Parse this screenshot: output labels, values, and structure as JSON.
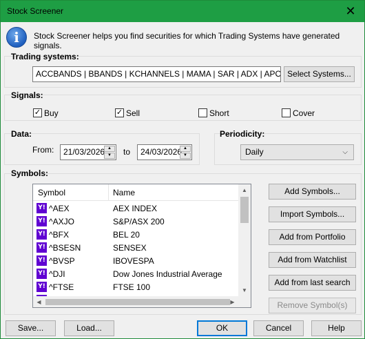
{
  "window": {
    "title": "Stock Screener",
    "close_glyph": "✕"
  },
  "info": {
    "icon": "info-icon",
    "icon_glyph": "i",
    "text": "Stock Screener helps you find securities for which Trading Systems have generated signals."
  },
  "trading_systems": {
    "label": "Trading systems:",
    "value": "ACCBANDS | BBANDS | KCHANNELS | MAMA | SAR | ADX | APO | A",
    "button": "Select Systems..."
  },
  "signals": {
    "label": "Signals:",
    "items": [
      {
        "label": "Buy",
        "checked": true
      },
      {
        "label": "Sell",
        "checked": true
      },
      {
        "label": "Short",
        "checked": false
      },
      {
        "label": "Cover",
        "checked": false
      }
    ]
  },
  "data": {
    "label": "Data:",
    "from_label": "From:",
    "from_value": "21/03/2026",
    "to_label": "to",
    "to_value": "24/03/2026"
  },
  "periodicity": {
    "label": "Periodicity:",
    "value": "Daily"
  },
  "symbols": {
    "label": "Symbols:",
    "columns": [
      "Symbol",
      "Name"
    ],
    "rows": [
      {
        "icon": "Y!",
        "symbol": "^AEX",
        "name": "AEX INDEX"
      },
      {
        "icon": "Y!",
        "symbol": "^AXJO",
        "name": "S&P/ASX 200"
      },
      {
        "icon": "Y!",
        "symbol": "^BFX",
        "name": "BEL 20"
      },
      {
        "icon": "Y!",
        "symbol": "^BSESN",
        "name": "SENSEX"
      },
      {
        "icon": "Y!",
        "symbol": "^BVSP",
        "name": "IBOVESPA"
      },
      {
        "icon": "Y!",
        "symbol": "^DJI",
        "name": "Dow Jones Industrial Average"
      },
      {
        "icon": "Y!",
        "symbol": "^FTSE",
        "name": "FTSE 100"
      }
    ],
    "buttons": [
      "Add Symbols...",
      "Import Symbols...",
      "Add from Portfolio",
      "Add from Watchlist",
      "Add from last search",
      "Remove Symbol(s)"
    ]
  },
  "footer": {
    "save": "Save...",
    "load": "Load...",
    "ok": "OK",
    "cancel": "Cancel",
    "help": "Help"
  },
  "colors": {
    "titlebar": "#1e9e44",
    "accent": "#0078d7",
    "yahoo": "#6001d2"
  }
}
